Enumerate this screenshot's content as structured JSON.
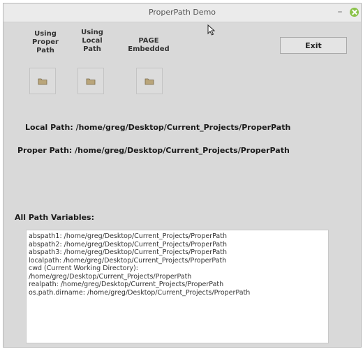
{
  "window": {
    "title": "ProperPath Demo",
    "minimize_glyph": "–"
  },
  "buttons": {
    "proper_path_label": "Using\nProper\nPath",
    "local_path_label": "Using\nLocal\nPath",
    "page_embedded_label": "PAGE\nEmbedded",
    "folder_icon": "folder-icon",
    "exit_label": "Exit"
  },
  "paths": {
    "local_path": "Local Path: /home/greg/Desktop/Current_Projects/ProperPath",
    "proper_path": "Proper Path: /home/greg/Desktop/Current_Projects/ProperPath"
  },
  "variables": {
    "heading": "All Path Variables:",
    "lines": [
      "abspath1: /home/greg/Desktop/Current_Projects/ProperPath",
      "abspath2: /home/greg/Desktop/Current_Projects/ProperPath",
      "abspath3: /home/greg/Desktop/Current_Projects/ProperPath",
      "localpath: /home/greg/Desktop/Current_Projects/ProperPath",
      "cwd (Current Working Directory):",
      "/home/greg/Desktop/Current_Projects/ProperPath",
      "realpath: /home/greg/Desktop/Current_Projects/ProperPath",
      "os.path.dirname: /home/greg/Desktop/Current_Projects/ProperPath"
    ]
  },
  "colors": {
    "window_bg": "#d9d9d9",
    "close_button": "#8bc34a",
    "folder_icon": "#a89868"
  }
}
